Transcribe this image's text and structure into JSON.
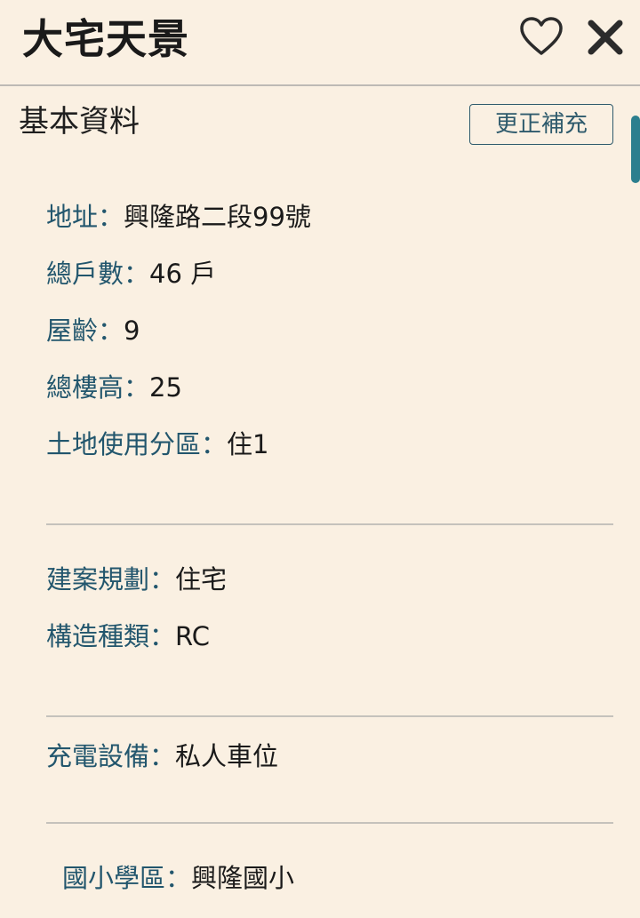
{
  "header": {
    "title": "大宅天景",
    "favorite_icon": "heart-outline-icon",
    "close_icon": "close-icon"
  },
  "section": {
    "title": "基本資料",
    "correct_button_label": "更正補充"
  },
  "groups": [
    {
      "fields": [
        {
          "label": "地址：",
          "value": "興隆路二段99號"
        },
        {
          "label": "總戶數：",
          "value": "46 戶"
        },
        {
          "label": "屋齡：",
          "value": "9"
        },
        {
          "label": "總樓高：",
          "value": "25"
        },
        {
          "label": "土地使用分區：",
          "value": "住1"
        }
      ]
    },
    {
      "fields": [
        {
          "label": "建案規劃：",
          "value": "住宅"
        },
        {
          "label": "構造種類：",
          "value": "RC"
        }
      ]
    },
    {
      "fields": [
        {
          "label": "充電設備：",
          "value": "私人車位"
        }
      ]
    },
    {
      "fields": [
        {
          "label": "國小學區：",
          "value": "興隆國小"
        }
      ]
    }
  ],
  "colors": {
    "background": "#faf0e2",
    "label": "#22566d",
    "value": "#1a1a1a",
    "accent": "#2c7f8e"
  }
}
